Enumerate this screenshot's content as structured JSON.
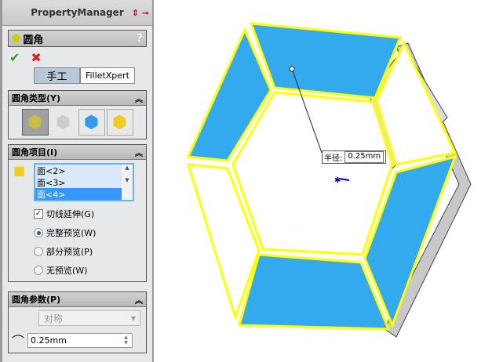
{
  "pm": {
    "title": "PropertyManager",
    "feature": "圆角",
    "help": "?"
  },
  "tabs": {
    "manual": "手工",
    "expert": "FilletXpert"
  },
  "type_group": {
    "title": "圆角类型(Y)"
  },
  "items_group": {
    "title": "圆角项目(I)",
    "items": [
      "面<2>",
      "面<3>",
      "面<4>"
    ],
    "tangent": "切线延伸(G)",
    "full_preview": "完整预览(W)",
    "partial_preview": "部分预览(P)",
    "no_preview": "无预览(W)"
  },
  "params_group": {
    "title": "圆角参数(P)",
    "method": "对称",
    "radius": "0.25mm"
  },
  "callout": {
    "label": "半径:",
    "value": "0.25mm"
  },
  "colors": {
    "face": "#33aaee",
    "edge": "#ffff00"
  }
}
